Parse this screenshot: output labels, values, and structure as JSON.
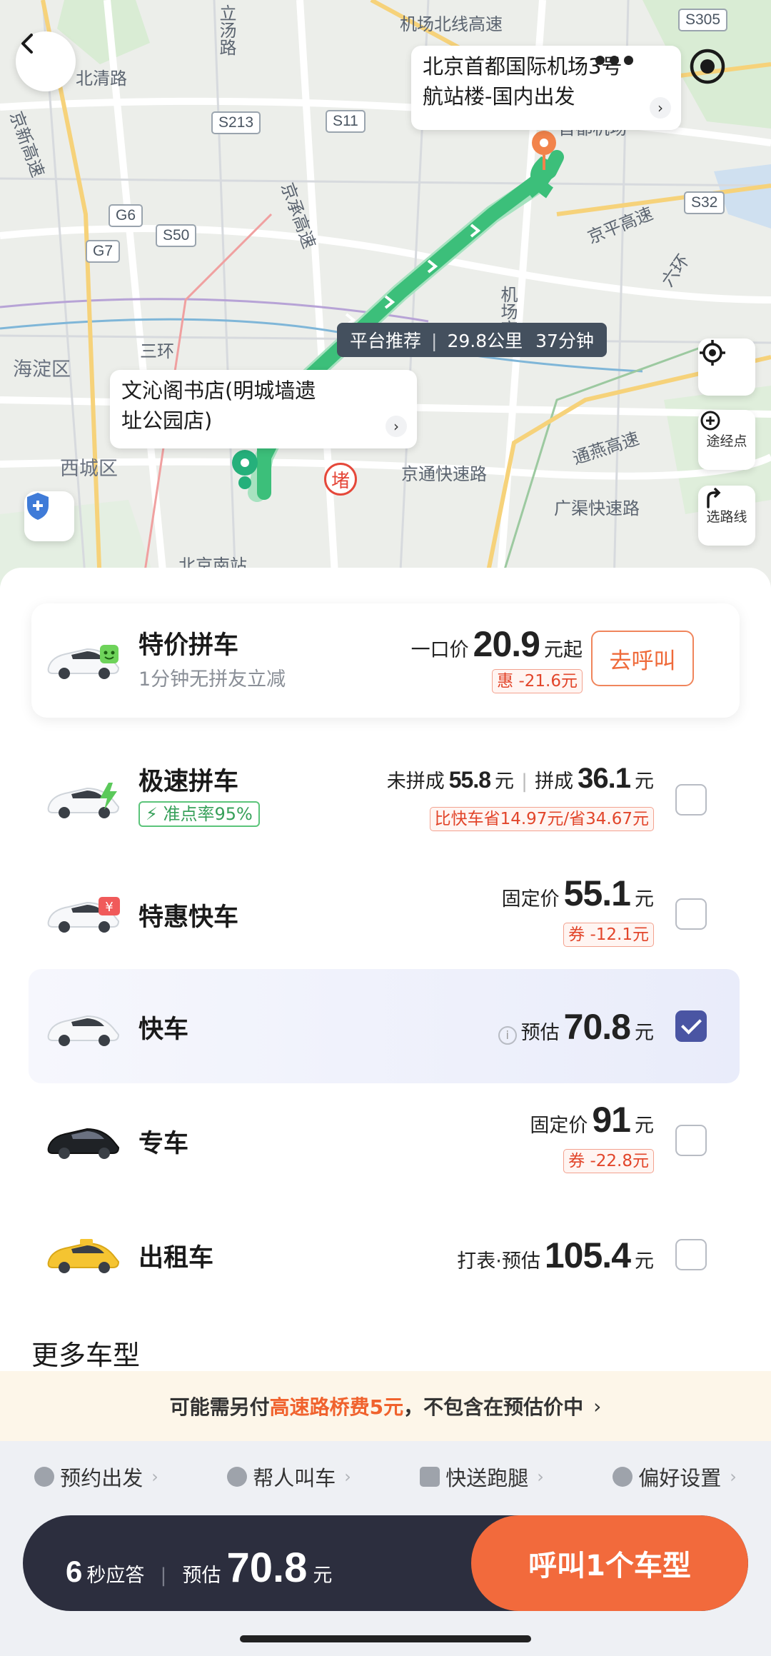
{
  "map": {
    "destination_line1": "北京首都国际机场3号",
    "destination_line2": "航站楼-国内出发",
    "origin_line1": "文沁阁书店(明城墙遗",
    "origin_line2": "址公园店)",
    "route_tag": {
      "label": "平台推荐",
      "distance": "29.8公里",
      "duration": "37分钟"
    },
    "via_label": "途经点",
    "route_select_label": "选路线",
    "traffic_badge": "堵",
    "labels": [
      "立汤路",
      "机场北线高速",
      "北清路",
      "京新高速",
      "京承高速",
      "京平高速",
      "六环",
      "机场高速",
      "通燕高速",
      "三环",
      "海淀区",
      "西城区",
      "京通快速路",
      "广渠快速路",
      "首都机场",
      "北京南站"
    ],
    "shields": [
      "S305",
      "S213",
      "S11",
      "G6",
      "S50",
      "G7",
      "S32"
    ]
  },
  "rides": [
    {
      "name": "特价拼车",
      "sub": "1分钟无拼友立减",
      "price_prefix": "一口价",
      "price": "20.9",
      "price_suffix": "元起",
      "discount": "惠 -21.6元",
      "button": "去呼叫"
    },
    {
      "name": "极速拼车",
      "accuracy": "准点率95%",
      "unmatched_label": "未拼成",
      "unmatched_price": "55.8",
      "unit": "元",
      "matched_label": "拼成",
      "matched_price": "36.1",
      "compare": "比快车省14.97元/省34.67元",
      "checked": false
    },
    {
      "name": "特惠快车",
      "price_prefix": "固定价",
      "price": "55.1",
      "unit": "元",
      "discount": "券 -12.1元",
      "checked": false
    },
    {
      "name": "快车",
      "price_prefix": "预估",
      "price": "70.8",
      "unit": "元",
      "checked": true
    },
    {
      "name": "专车",
      "price_prefix": "固定价",
      "price": "91",
      "unit": "元",
      "discount": "券 -22.8元",
      "checked": false
    },
    {
      "name": "出租车",
      "price_prefix": "打表·预估",
      "price": "105.4",
      "unit": "元",
      "checked": false
    }
  ],
  "more_title": "更多车型",
  "toll": {
    "prefix": "可能需另付",
    "highlight": "高速路桥费5元",
    "suffix": "，不包含在预估价中"
  },
  "options": [
    "预约出发",
    "帮人叫车",
    "快送跑腿",
    "偏好设置"
  ],
  "bottom": {
    "eta_num": "6",
    "eta_text": "秒应答",
    "est_label": "预估",
    "est_price": "70.8",
    "unit": "元",
    "call_label": "呼叫1个车型"
  },
  "colors": {
    "accent": "#f26a3c",
    "route_green": "#3cbf7a",
    "selected": "#4a55a3",
    "bar_dark": "#2c2e3e"
  }
}
